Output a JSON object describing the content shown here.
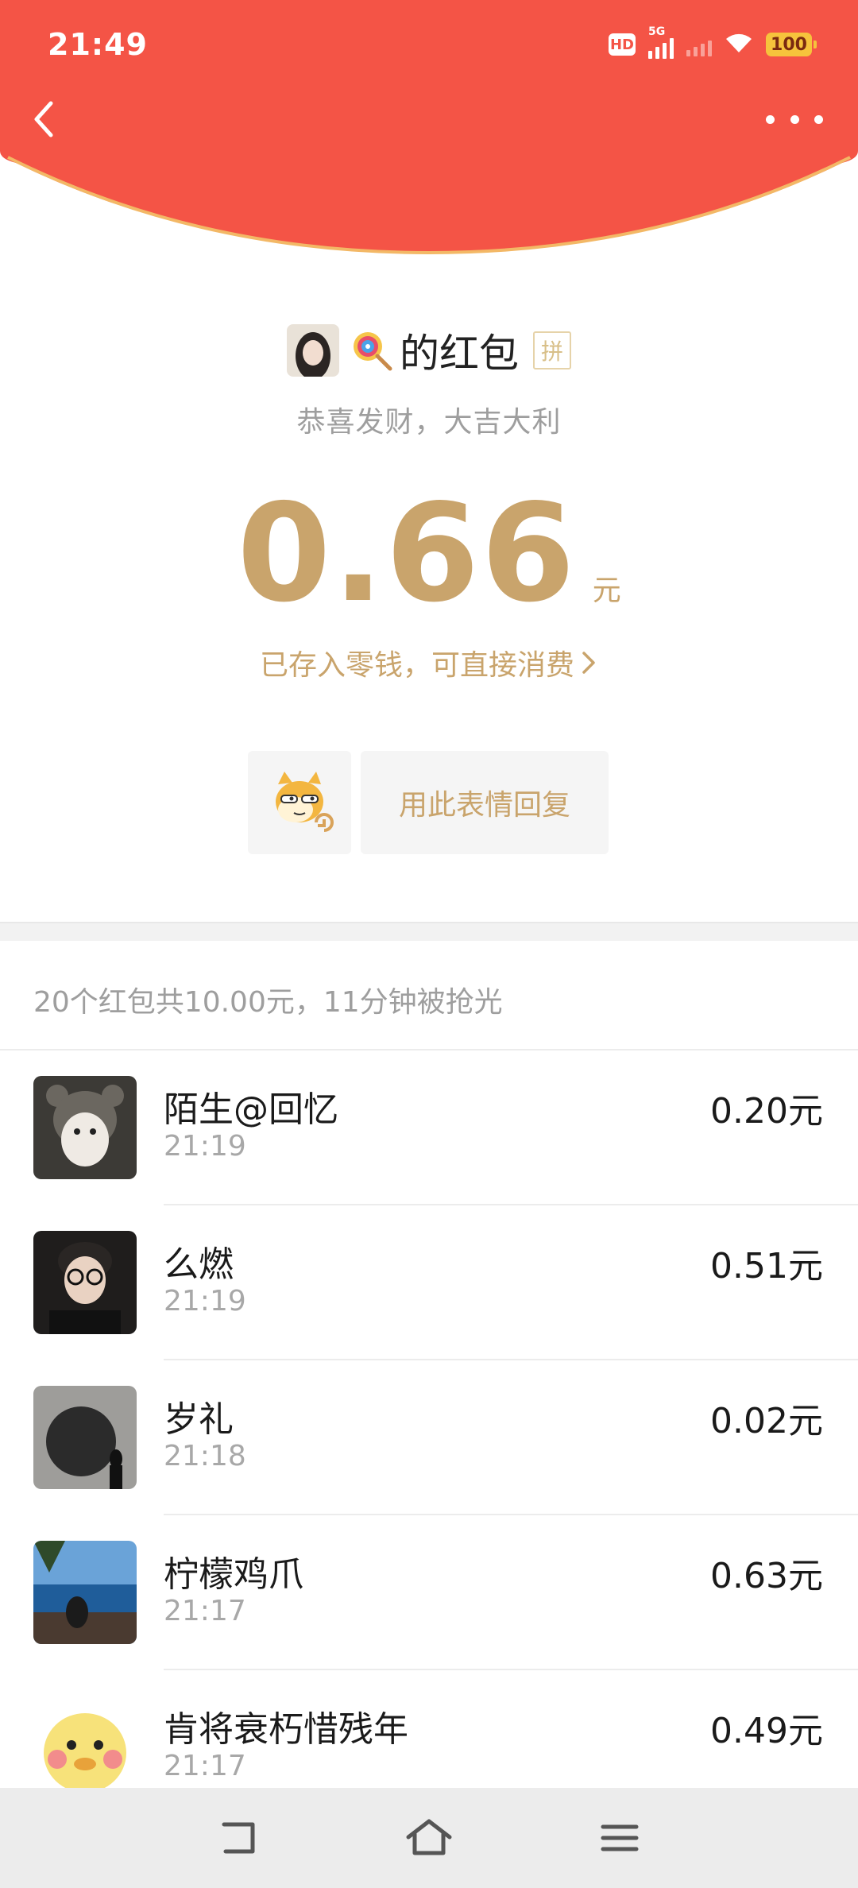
{
  "status_bar": {
    "time": "21:49",
    "hd_label": "HD",
    "network_label": "5G",
    "battery": "100"
  },
  "header": {
    "back_icon": "chevron-left-icon",
    "more_icon": "more-dots-icon",
    "color": "#f45446",
    "border_color": "#f3b866"
  },
  "sender": {
    "title": "的红包",
    "pin_badge": "拼",
    "wish": "恭喜发财，大吉大利"
  },
  "amount": {
    "value": "0.66",
    "unit": "元",
    "saved_text": "已存入零钱，可直接消费"
  },
  "reply": {
    "label": "用此表情回复"
  },
  "summary": {
    "text": "20个红包共10.00元，11分钟被抢光"
  },
  "recipients": [
    {
      "name": "陌生@回忆",
      "time": "21:19",
      "amount": "0.20元"
    },
    {
      "name": "么燃",
      "time": "21:19",
      "amount": "0.51元"
    },
    {
      "name": "岁礼",
      "time": "21:18",
      "amount": "0.02元"
    },
    {
      "name": "柠檬鸡爪",
      "time": "21:17",
      "amount": "0.63元"
    },
    {
      "name": "肯将衰朽惜残年",
      "time": "21:17",
      "amount": "0.49元"
    }
  ],
  "colors": {
    "accent_gold": "#c9a46c",
    "gray_text": "#9e9e9e"
  }
}
